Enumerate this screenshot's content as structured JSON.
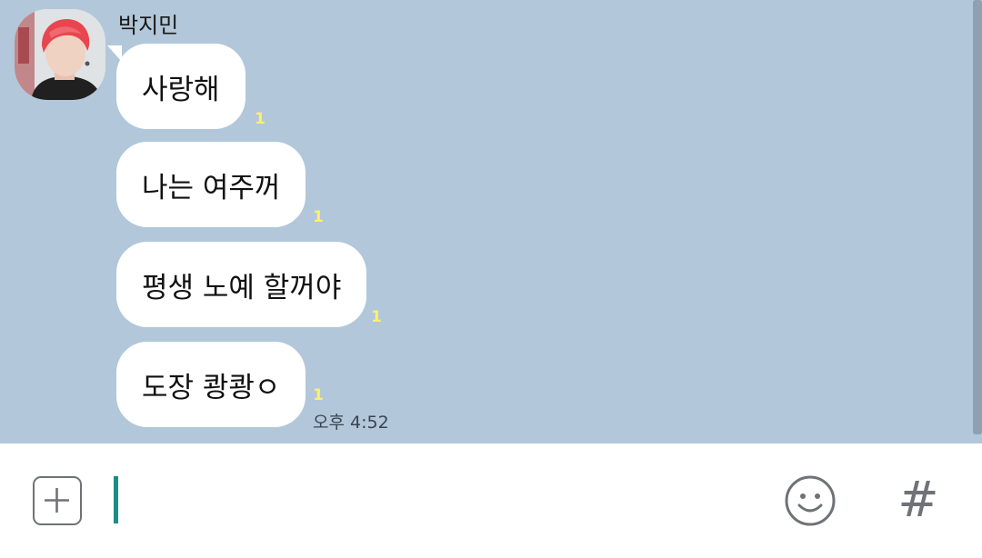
{
  "colors": {
    "chat_background": "#b2c7da",
    "bubble": "#ffffff",
    "unread_count": "#fff06a",
    "caret": "#1b8c86",
    "icon_gray": "#6f7276"
  },
  "conversation": {
    "sender_name": "박지민",
    "avatar_icon": "profile-photo",
    "messages": [
      {
        "text": "사랑해",
        "unread": "1"
      },
      {
        "text": "나는 여주꺼",
        "unread": "1"
      },
      {
        "text": "평생 노예 할꺼야",
        "unread": "1"
      },
      {
        "text": "도장 쾅쾅ㅇ",
        "unread": "1"
      }
    ],
    "last_time": "오후 4:52"
  },
  "input_bar": {
    "message_value": "",
    "plus_icon": "plus-square-icon",
    "emoji_icon": "smiley-icon",
    "hash_label": "#"
  }
}
